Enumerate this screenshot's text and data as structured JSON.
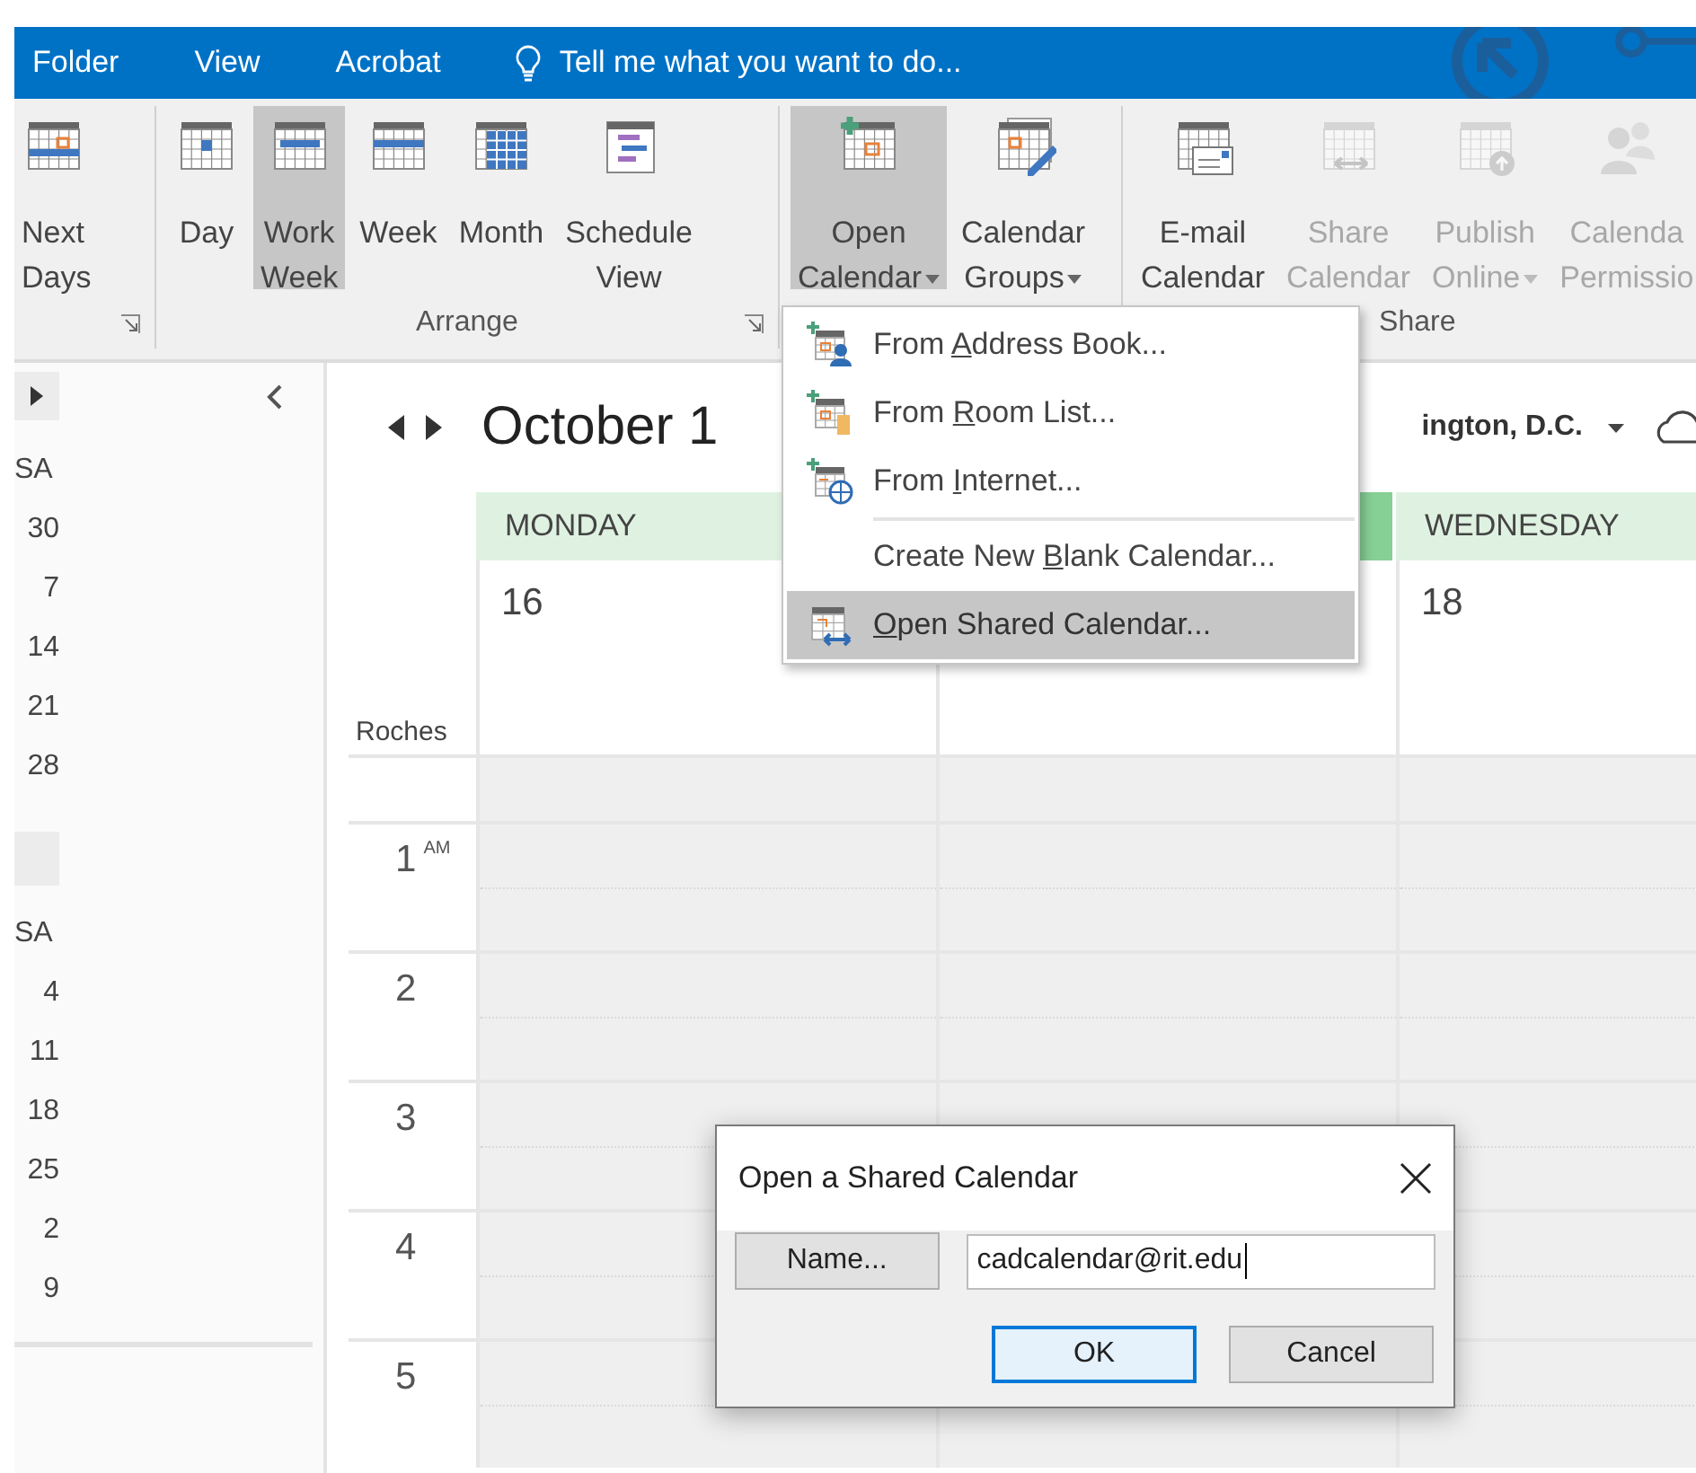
{
  "top_menu": {
    "tabs": [
      {
        "label": "Folder"
      },
      {
        "label": "View"
      },
      {
        "label": "Acrobat"
      }
    ],
    "tell_me": "Tell me what you want to do..."
  },
  "ribbon": {
    "groups": [
      {
        "launcher": true,
        "buttons": [
          {
            "kind": "next-days",
            "lines": [
              "Next",
              "Days"
            ],
            "selected": false,
            "disabled": false,
            "dropdown": false
          }
        ]
      },
      {
        "label": "Arrange",
        "launcher": true,
        "buttons": [
          {
            "kind": "day",
            "lines": [
              "Day"
            ],
            "selected": false,
            "disabled": false,
            "dropdown": false
          },
          {
            "kind": "work-week",
            "lines": [
              "Work",
              "Week"
            ],
            "selected": true,
            "disabled": false,
            "dropdown": false
          },
          {
            "kind": "week",
            "lines": [
              "Week"
            ],
            "selected": false,
            "disabled": false,
            "dropdown": false
          },
          {
            "kind": "month",
            "lines": [
              "Month"
            ],
            "selected": false,
            "disabled": false,
            "dropdown": false
          },
          {
            "kind": "schedule",
            "lines": [
              "Schedule",
              "View"
            ],
            "selected": false,
            "disabled": false,
            "dropdown": false
          }
        ]
      },
      {
        "launcher": false,
        "buttons": [
          {
            "kind": "open",
            "lines": [
              "Open",
              "Calendar"
            ],
            "selected": true,
            "disabled": false,
            "dropdown": true
          },
          {
            "kind": "groups",
            "lines": [
              "Calendar",
              "Groups"
            ],
            "selected": false,
            "disabled": false,
            "dropdown": true
          }
        ]
      },
      {
        "label": "Share",
        "launcher": false,
        "buttons": [
          {
            "kind": "email",
            "lines": [
              "E-mail",
              "Calendar"
            ],
            "selected": false,
            "disabled": false,
            "dropdown": false
          },
          {
            "kind": "share",
            "lines": [
              "Share",
              "Calendar"
            ],
            "selected": false,
            "disabled": true,
            "dropdown": false
          },
          {
            "kind": "publish",
            "lines": [
              "Publish",
              "Online"
            ],
            "selected": false,
            "disabled": true,
            "dropdown": true
          },
          {
            "kind": "permission",
            "lines": [
              "Calenda",
              "Permissio"
            ],
            "selected": false,
            "disabled": true,
            "dropdown": false
          }
        ]
      }
    ]
  },
  "navigation": {
    "mini_calendars": [
      {
        "header": "SA",
        "dates": [
          "30",
          "7",
          "14",
          "21",
          "28"
        ]
      },
      {
        "header": "SA",
        "dates": [
          "4",
          "11",
          "18",
          "25",
          "2",
          "9"
        ]
      }
    ]
  },
  "calendar": {
    "title": "October 1",
    "location": "ington, D.C.",
    "timezone": "Roches",
    "days": [
      {
        "name": "MONDAY",
        "date": "16",
        "today": false
      },
      {
        "today": true
      },
      {
        "name": "WEDNESDAY",
        "date": "18",
        "today": false
      }
    ],
    "hours": [
      {
        "hour": "1",
        "period": "AM"
      },
      {
        "hour": "2"
      },
      {
        "hour": "3"
      },
      {
        "hour": "4"
      },
      {
        "hour": "5"
      }
    ]
  },
  "open_calendar_menu": {
    "items": [
      {
        "kind": "address",
        "before": "From ",
        "key": "A",
        "after": "ddress Book...",
        "selected": false
      },
      {
        "kind": "room",
        "before": "From ",
        "key": "R",
        "after": "oom List...",
        "selected": false
      },
      {
        "kind": "internet",
        "before": "From ",
        "key": "I",
        "after": "nternet...",
        "selected": false
      },
      {
        "kind": "separator"
      },
      {
        "kind": "blank",
        "before": "Create New ",
        "key": "B",
        "after": "lank Calendar...",
        "selected": false
      },
      {
        "kind": "shared",
        "key": "O",
        "after": "pen Shared Calendar...",
        "selected": true
      }
    ]
  },
  "dialog": {
    "title": "Open a Shared Calendar",
    "name_button": "Name...",
    "input_value": "cadcalendar@rit.edu",
    "buttons": [
      {
        "label": "OK",
        "default": true
      },
      {
        "label": "Cancel",
        "default": false
      }
    ]
  }
}
